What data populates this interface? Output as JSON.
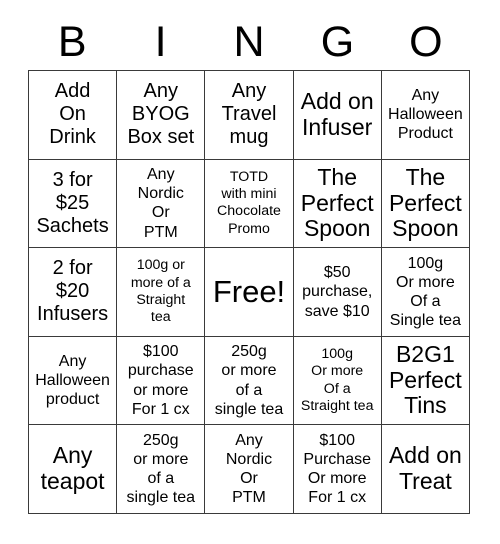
{
  "header": {
    "letters": [
      "B",
      "I",
      "N",
      "G",
      "O"
    ]
  },
  "grid": {
    "rows": 5,
    "columns": 5,
    "border_color": "#3a3a3a",
    "background_color": "#ffffff",
    "text_color": "#000000",
    "cells": [
      {
        "text": "Add\nOn\nDrink",
        "size": "md",
        "free": false
      },
      {
        "text": "Any\nBYOG\nBox set",
        "size": "md",
        "free": false
      },
      {
        "text": "Any\nTravel\nmug",
        "size": "md",
        "free": false
      },
      {
        "text": "Add on\nInfuser",
        "size": "lg",
        "free": false
      },
      {
        "text": "Any\nHalloween\nProduct",
        "size": "sm",
        "free": false
      },
      {
        "text": "3 for\n$25\nSachets",
        "size": "md",
        "free": false
      },
      {
        "text": "Any\nNordic\nOr\nPTM",
        "size": "sm",
        "free": false
      },
      {
        "text": "TOTD\nwith mini\nChocolate\nPromo",
        "size": "xs",
        "free": false
      },
      {
        "text": "The\nPerfect\nSpoon",
        "size": "lg",
        "free": false
      },
      {
        "text": "The\nPerfect\nSpoon",
        "size": "lg",
        "free": false
      },
      {
        "text": "2 for\n$20\nInfusers",
        "size": "md",
        "free": false
      },
      {
        "text": "100g or\nmore of a\nStraight\ntea",
        "size": "xs",
        "free": false
      },
      {
        "text": "Free!",
        "size": "xl",
        "free": true
      },
      {
        "text": "$50\npurchase,\nsave $10",
        "size": "sm",
        "free": false
      },
      {
        "text": "100g\nOr more\nOf a\nSingle tea",
        "size": "sm",
        "free": false
      },
      {
        "text": "Any\nHalloween\nproduct",
        "size": "sm",
        "free": false
      },
      {
        "text": "$100\npurchase\nor more\nFor 1 cx",
        "size": "sm",
        "free": false
      },
      {
        "text": "250g\nor more\nof a\nsingle tea",
        "size": "sm",
        "free": false
      },
      {
        "text": "100g\nOr more\nOf a\nStraight tea",
        "size": "xs",
        "free": false
      },
      {
        "text": "B2G1\nPerfect\nTins",
        "size": "lg",
        "free": false
      },
      {
        "text": "Any\nteapot",
        "size": "lg",
        "free": false
      },
      {
        "text": "250g\nor more\nof a\nsingle tea",
        "size": "sm",
        "free": false
      },
      {
        "text": "Any\nNordic\nOr\nPTM",
        "size": "sm",
        "free": false
      },
      {
        "text": "$100\nPurchase\nOr more\nFor 1 cx",
        "size": "sm",
        "free": false
      },
      {
        "text": "Add on\nTreat",
        "size": "lg",
        "free": false
      }
    ]
  }
}
